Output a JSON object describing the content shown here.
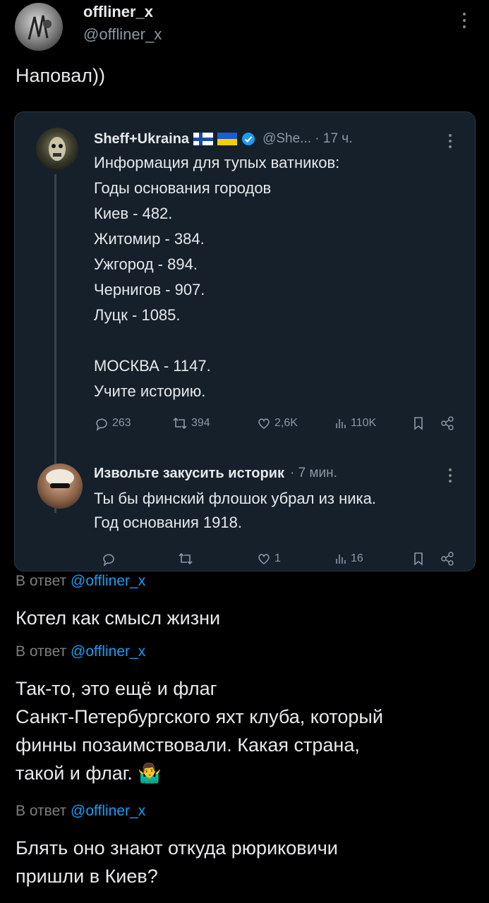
{
  "post": {
    "author_name": "offliner_x",
    "author_handle": "@offliner_x",
    "body": "Наповал))"
  },
  "quote": {
    "author_name": "Sheff+Ukraina",
    "handle_time": "@She... · 17 ч.",
    "lines": [
      "Информация для тупых ватников:",
      "Годы основания городов",
      "Киев - 482.",
      "Житомир - 384.",
      "Ужгород - 894.",
      "Чернигов - 907.",
      "Луцк - 1085.",
      "",
      "МОСКВА - 1147.",
      "Учите историю."
    ],
    "stats": {
      "replies": "263",
      "reposts": "394",
      "likes": "2,6K",
      "views": "110K"
    }
  },
  "inner_reply": {
    "author_name": "Извольте закусить историк",
    "time": "· 7 мин.",
    "lines": [
      "Ты бы финский флошок убрал из ника.",
      "Год основания 1918."
    ],
    "stats": {
      "replies": "",
      "reposts": "",
      "likes": "1",
      "views": "16"
    }
  },
  "comments": [
    {
      "reply_prefix": "В ответ",
      "reply_to": "@offliner_x",
      "text_lines": [
        "Котел как смысл жизни"
      ]
    },
    {
      "reply_prefix": "В ответ",
      "reply_to": "@offliner_x",
      "text_lines": [
        "Так-то, это ещё и флаг",
        "Санкт-Петербургского яхт клуба, который",
        "финны позаимствовали. Какая страна,",
        "такой и флаг. 🤷‍♂️"
      ]
    },
    {
      "reply_prefix": "В ответ",
      "reply_to": "@offliner_x",
      "text_lines": [
        "Блять оно знают откуда рюриковичи",
        "пришли в Киев?"
      ]
    }
  ],
  "colors": {
    "background": "#000000",
    "card": "#15202b",
    "link": "#1d9bf0",
    "verified": "#1d9bf0"
  }
}
